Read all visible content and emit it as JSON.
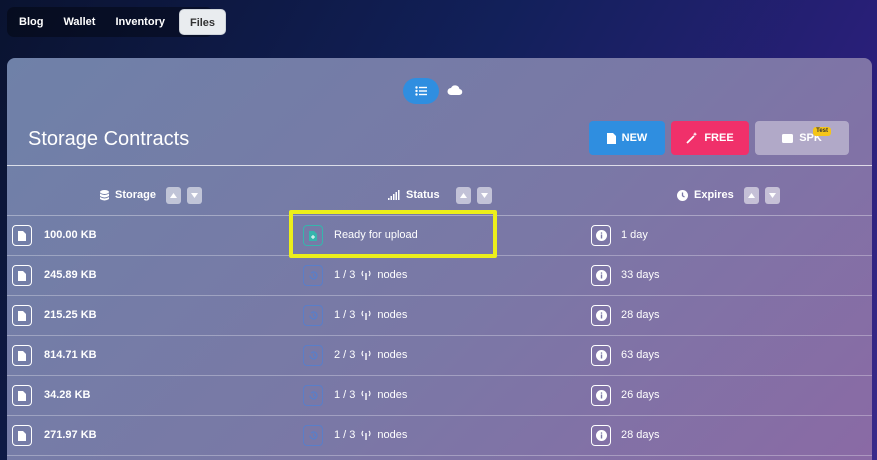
{
  "nav": {
    "tabs": [
      {
        "label": "Blog"
      },
      {
        "label": "Wallet"
      },
      {
        "label": "Inventory"
      },
      {
        "label": "Files"
      }
    ]
  },
  "header": {
    "title": "Storage Contracts",
    "buttons": {
      "new": "NEW",
      "free": "FREE",
      "spk": "SPK",
      "spk_badge": "Test"
    }
  },
  "table": {
    "columns": {
      "storage": "Storage",
      "status": "Status",
      "expires": "Expires"
    },
    "rows": [
      {
        "size": "100.00 KB",
        "status": "Ready for upload",
        "expires": "1 day"
      },
      {
        "size": "245.89 KB",
        "status": "1 / 3",
        "nodes_label": "nodes",
        "expires": "33 days"
      },
      {
        "size": "215.25 KB",
        "status": "1 / 3",
        "nodes_label": "nodes",
        "expires": "28 days"
      },
      {
        "size": "814.71 KB",
        "status": "2 / 3",
        "nodes_label": "nodes",
        "expires": "63 days"
      },
      {
        "size": "34.28 KB",
        "status": "1 / 3",
        "nodes_label": "nodes",
        "expires": "26 days"
      },
      {
        "size": "271.97 KB",
        "status": "1 / 3",
        "nodes_label": "nodes",
        "expires": "28 days"
      }
    ]
  },
  "colors": {
    "primary": "#2f8ee0",
    "danger": "#f0306a",
    "highlight": "#ecef1a"
  }
}
